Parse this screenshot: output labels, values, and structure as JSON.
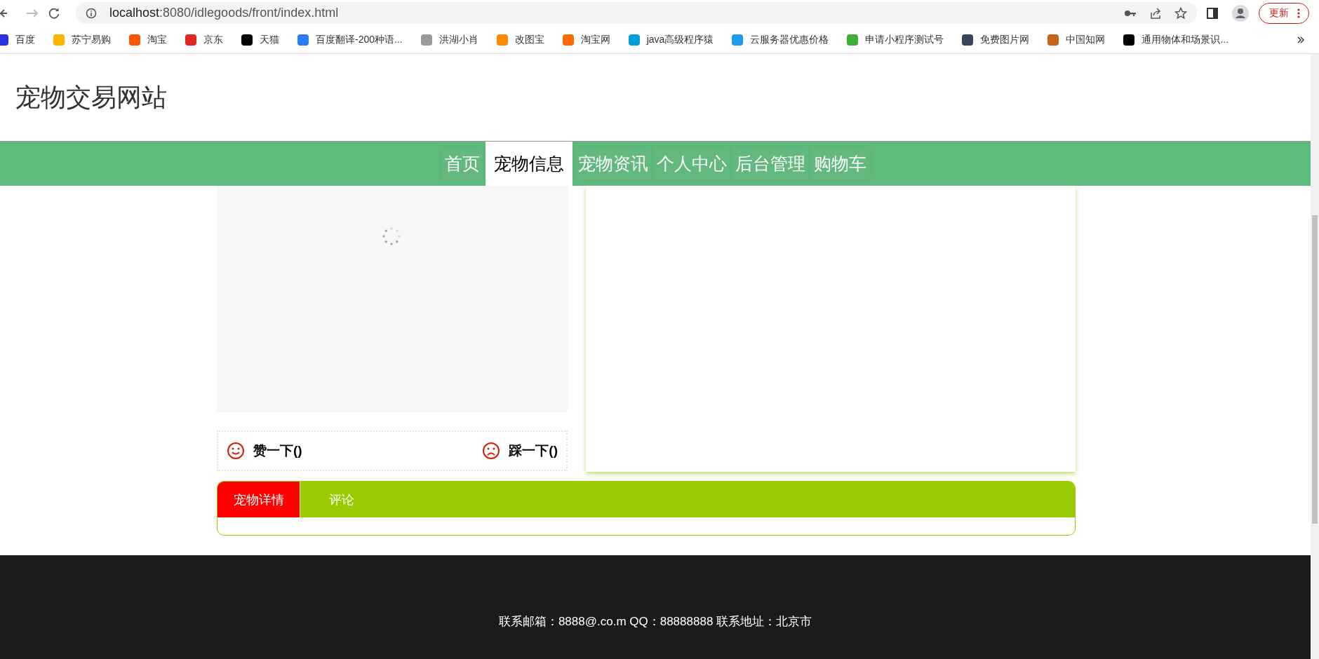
{
  "browser": {
    "url_host": "localhost",
    "url_rest": ":8080/idlegoods/front/index.html",
    "update_button": "更新"
  },
  "bookmarks": [
    {
      "label": "百度",
      "color": "#2932e1"
    },
    {
      "label": "苏宁易购",
      "color": "#f7b500"
    },
    {
      "label": "淘宝",
      "color": "#ff5500"
    },
    {
      "label": "京东",
      "color": "#e1251b"
    },
    {
      "label": "天猫",
      "color": "#000000"
    },
    {
      "label": "百度翻译-200种语...",
      "color": "#2b7cf6"
    },
    {
      "label": "洪湖小肖",
      "color": "#9a9a9a"
    },
    {
      "label": "改图宝",
      "color": "#ff8a00"
    },
    {
      "label": "淘宝网",
      "color": "#ff6a00"
    },
    {
      "label": "java高级程序猿",
      "color": "#00a1d6"
    },
    {
      "label": "云服务器优惠价格",
      "color": "#1e9bf0"
    },
    {
      "label": "申请小程序测试号",
      "color": "#3cb034"
    },
    {
      "label": "免费图片网",
      "color": "#35465c"
    },
    {
      "label": "中国知网",
      "color": "#c8651b"
    },
    {
      "label": "通用物体和场景识...",
      "color": "#000000"
    }
  ],
  "site_title": "宠物交易网站",
  "nav": [
    {
      "label": "首页",
      "selected": false
    },
    {
      "label": "宠物信息",
      "selected": true
    },
    {
      "label": "宠物资讯",
      "selected": false
    },
    {
      "label": "个人中心",
      "selected": false
    },
    {
      "label": "后台管理",
      "selected": false
    },
    {
      "label": "购物车",
      "selected": false
    }
  ],
  "votes": {
    "like": "赞一下()",
    "dislike": "踩一下()"
  },
  "detail_tabs": [
    {
      "label": "宠物详情",
      "selected": true
    },
    {
      "label": "评论",
      "selected": false
    }
  ],
  "footer": "联系邮箱：8888@.co.m QQ：88888888 联系地址：北京市"
}
